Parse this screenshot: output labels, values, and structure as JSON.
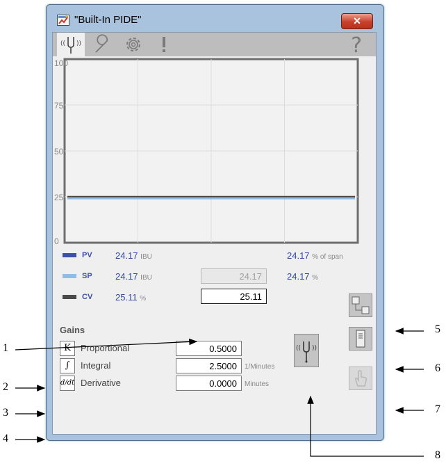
{
  "window": {
    "title": "\"Built-In PIDE\"",
    "close_label": "✕"
  },
  "tabs": [
    {
      "name": "operator",
      "icon": "tuning-fork-icon",
      "active": true
    },
    {
      "name": "maintenance",
      "icon": "wrench-icon"
    },
    {
      "name": "engineering",
      "icon": "gear-icon"
    },
    {
      "name": "alarms",
      "icon": "exclamation-icon"
    }
  ],
  "help_label": "?",
  "trend": {
    "y_ticks": [
      "100",
      "75",
      "50",
      "25",
      "0"
    ]
  },
  "chart_data": {
    "type": "line",
    "ylim": [
      0,
      100
    ],
    "y_ticks": [
      100,
      75,
      50,
      25,
      0
    ],
    "grid": true,
    "series": [
      {
        "name": "PV",
        "color": "#3c50a8",
        "values": [
          24.17,
          24.17
        ]
      },
      {
        "name": "SP",
        "color": "#8fbde6",
        "values": [
          24.17,
          24.17
        ]
      },
      {
        "name": "CV",
        "color": "#444444",
        "values": [
          25.11,
          25.11
        ]
      }
    ]
  },
  "pens": {
    "pv": {
      "label": "PV",
      "value": "24.17",
      "unit": "IBU",
      "pct_value": "24.17",
      "pct_unit": "% of span",
      "color": "#3c50a8"
    },
    "sp": {
      "label": "SP",
      "value": "24.17",
      "unit": "IBU",
      "field_value": "24.17",
      "pct_value": "24.17",
      "pct_unit": "%",
      "color": "#8fbde6"
    },
    "cv": {
      "label": "CV",
      "value": "25.11",
      "unit": "%",
      "field_value": "25.11",
      "color": "#4a4a4a"
    }
  },
  "gains": {
    "title": "Gains",
    "proportional": {
      "icon_text": "K",
      "label": "Proportional",
      "value": "0.5000",
      "unit": ""
    },
    "integral": {
      "icon_text": "∫",
      "label": "Integral",
      "value": "2.5000",
      "unit": "1/Minutes"
    },
    "derivative": {
      "icon_text": "d/dt",
      "label": "Derivative",
      "value": "0.0000",
      "unit": "Minutes"
    }
  },
  "callouts": [
    "1",
    "2",
    "3",
    "4",
    "5",
    "6",
    "7",
    "8"
  ]
}
